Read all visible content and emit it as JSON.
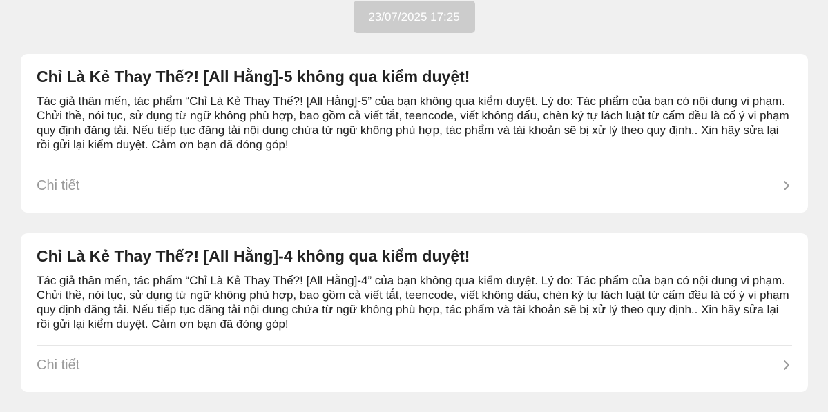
{
  "timestamp": "23/07/2025 17:25",
  "notifications": [
    {
      "title": "Chỉ Là Kẻ Thay Thế?! [All Hằng]-5 không qua kiểm duyệt!",
      "body": "Tác giả thân mến, tác phẩm “Chỉ Là Kẻ Thay Thế?! [All Hằng]-5” của bạn không qua kiểm duyệt. Lý do: Tác phẩm của bạn có nội dung vi phạm. Chửi thề, nói tục, sử dụng từ ngữ không phù hợp, bao gồm cả viết tắt, teencode, viết không dấu, chèn ký tự lách luật từ cấm đều là cố ý vi phạm quy định đăng tải. Nếu tiếp tục đăng tải nội dung chứa từ ngữ không phù hợp, tác phẩm và tài khoản sẽ bị xử lý theo quy định.. Xin hãy sửa lại rồi gửi lại kiểm duyệt. Cảm ơn bạn đã đóng góp!",
      "detail_label": "Chi tiết",
      "detail_icon": "chevron-right-icon"
    },
    {
      "title": "Chỉ Là Kẻ Thay Thế?! [All Hằng]-4 không qua kiểm duyệt!",
      "body": "Tác giả thân mến, tác phẩm “Chỉ Là Kẻ Thay Thế?! [All Hằng]-4” của bạn không qua kiểm duyệt. Lý do: Tác phẩm của bạn có nội dung vi phạm. Chửi thề, nói tục, sử dụng từ ngữ không phù hợp, bao gồm cả viết tắt, teencode, viết không dấu, chèn ký tự lách luật từ cấm đều là cố ý vi phạm quy định đăng tải. Nếu tiếp tục đăng tải nội dung chứa từ ngữ không phù hợp, tác phẩm và tài khoản sẽ bị xử lý theo quy định.. Xin hãy sửa lại rồi gửi lại kiểm duyệt. Cảm ơn bạn đã đóng góp!",
      "detail_label": "Chi tiết",
      "detail_icon": "chevron-right-icon"
    }
  ],
  "colors": {
    "background": "#f0f0f0",
    "card": "#ffffff",
    "timestamp_bg": "#cccccc",
    "muted_text": "#9a9a9a"
  }
}
